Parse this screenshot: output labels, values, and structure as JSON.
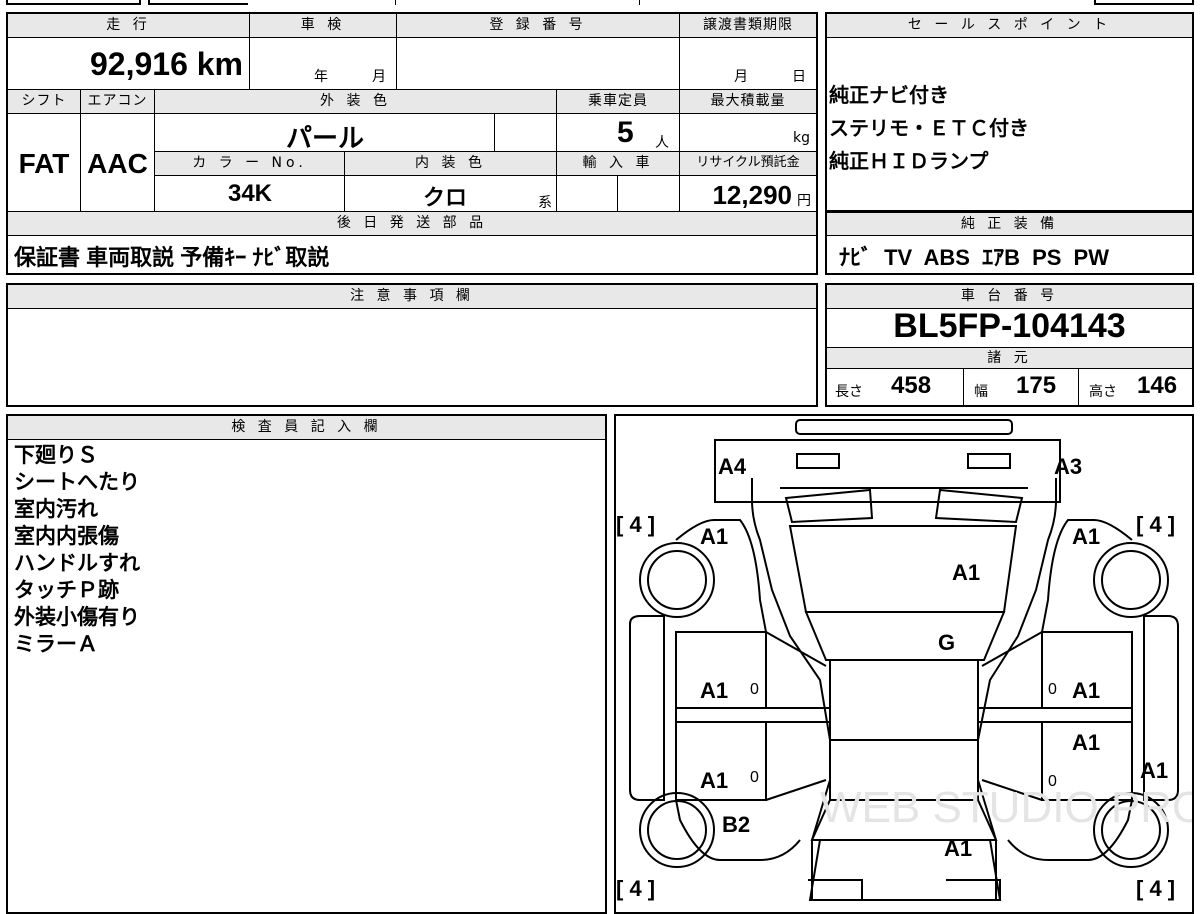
{
  "top_block": {
    "mileage_label": "走 行",
    "mileage_value": "92,916 km",
    "inspection_label": "車 検",
    "inspection_year_unit": "年",
    "inspection_month_unit": "月",
    "registration_label": "登 録 番 号",
    "transfer_label": "譲渡書類期限",
    "transfer_month_unit": "月",
    "transfer_day_unit": "日",
    "shift_label": "シフト",
    "shift_value": "FAT",
    "aircon_label": "エアコン",
    "aircon_value": "AAC",
    "exterior_label": "外 装 色",
    "exterior_value": "パール",
    "capacity_label": "乗車定員",
    "capacity_value": "5",
    "capacity_unit": "人",
    "maxload_label": "最大積載量",
    "maxload_unit": "kg",
    "color_no_label": "カ ラ ー No.",
    "color_no_value": "34K",
    "interior_label": "内 装 色",
    "interior_value": "クロ",
    "interior_unit": "系",
    "import_label": "輸 入 車",
    "recycle_label": "リサイクル預託金",
    "recycle_value": "12,290",
    "recycle_unit": "円",
    "later_parts_label": "後 日 発 送 部 品",
    "later_parts_value": "保証書 車両取説 予備ｷｰ ﾅﾋﾞ取説"
  },
  "sales_points": {
    "label": "セ ー ル ス ポ イ ン ト",
    "items": [
      "純正ナビ付き",
      "ステリモ・ＥＴＣ付き",
      "純正ＨＩＤランプ"
    ]
  },
  "equipment": {
    "label": "純 正 装 備",
    "value": "ﾅﾋﾞ TV ABS ｴｱB PS PW"
  },
  "notes": {
    "label": "注 意 事 項 欄",
    "value": ""
  },
  "chassis": {
    "label": "車 台 番 号",
    "value": "BL5FP-104143",
    "specs_label": "諸 元",
    "length_label": "長さ",
    "length_value": "458",
    "width_label": "幅",
    "width_value": "175",
    "height_label": "高さ",
    "height_value": "146"
  },
  "inspector": {
    "label": "検 査 員 記 入 欄",
    "lines": [
      "下廻りＳ",
      "シートへたり",
      "室内汚れ",
      "室内内張傷",
      "ハンドルすれ",
      "タッチＰ跡",
      "外装小傷有り",
      "ミラーＡ"
    ]
  },
  "diagram": {
    "marks": [
      "A4",
      "A3",
      "A1",
      "A1",
      "A1",
      "G",
      "A1",
      "A1",
      "A1",
      "A1",
      "A1",
      "A1",
      "B2",
      "A1"
    ],
    "tire_marks": [
      "[ 4 ]",
      "[ 4 ]",
      "[ 4 ]",
      "[ 4 ]"
    ],
    "zero_marks": [
      "0",
      "0",
      "0",
      "0"
    ],
    "watermark": "WEB STUDIO PRO"
  }
}
